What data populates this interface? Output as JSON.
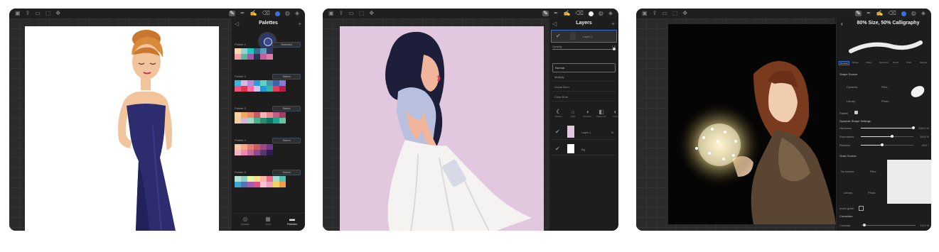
{
  "screen1": {
    "panel_title": "Palettes",
    "palettes": [
      {
        "name": "Palette 1",
        "button": "Selected",
        "colors": [
          "#f6d9b3",
          "#9ad0c8",
          "#1fc7c1",
          "#3c6c8a",
          "#5a9fc0",
          "#3a3a6a",
          "#f1a1a9",
          "#5fb3a0",
          "#9b5ea6",
          "#27344d",
          "#c55e9c",
          "#e07aa8"
        ]
      },
      {
        "name": "Palette 2",
        "button": "Select",
        "colors": [
          "#3fb3d7",
          "#d9b2e6",
          "#b58ad8",
          "#2e9bd8",
          "#5fd2c4",
          "#4a8fb0",
          "#3c64a8",
          "#8a7ad6",
          "#f0557b",
          "#e7334a",
          "#ff6b9a",
          "#d8c3e8",
          "#1e9ad6",
          "#2dbba3",
          "#e33d5f",
          "#b71e45"
        ]
      },
      {
        "name": "Palette 3",
        "button": "Select",
        "colors": [
          "#f6d3a1",
          "#f0a85a",
          "#e88a6c",
          "#c95a6a",
          "#f6b2b7",
          "#e9848f",
          "#c25d82",
          "#a33f5e",
          "#f1cfa1",
          "#d7b4d3",
          "#a4d7c7",
          "#4bb38b",
          "#2c8a6e",
          "#0b7763",
          "#1da38d",
          "#67c59f"
        ]
      },
      {
        "name": "Palette 4",
        "button": "Select",
        "colors": [
          "#f4c9a8",
          "#f7a68a",
          "#e67b72",
          "#cc5a63",
          "#9a4a83",
          "#6b3a8e",
          "#f3b3c8",
          "#e98bb0",
          "#c4669c",
          "#8c4c8c",
          "#55386d",
          "#2d1e4f"
        ]
      },
      {
        "name": "Palette 5",
        "button": "Select",
        "colors": [
          "#b8e3d0",
          "#8fd1c2",
          "#e6f5a7",
          "#f9e28c",
          "#f7b7a3",
          "#e86d8d",
          "#9fe0d3",
          "#56c3b0",
          "#3fa6c9",
          "#5471b9",
          "#a45bb4",
          "#e24e86",
          "#f7c3d5",
          "#f19bbd",
          "#f2d15a",
          "#f59b4b"
        ]
      }
    ],
    "bottom_tabs": [
      "Details",
      "Grid",
      "Palettes"
    ]
  },
  "screen2": {
    "panel_title": "Layers",
    "layer_top": "Layer 2",
    "opacity_label": "Opacity",
    "opacity_value": "1.0",
    "blend_modes": [
      "Normal",
      "Multiply",
      "Linear Burn",
      "Color Burn"
    ],
    "mode_tabs": [
      "Darken",
      "Light",
      "Contrast",
      "Difference",
      "Color"
    ],
    "layers": [
      "Layer 1",
      "Bg"
    ]
  },
  "screen3": {
    "panel_title": "80% Size, 50% Calligraphy",
    "tabs": [
      "General",
      "Stroke",
      "Shape",
      "Dynamics",
      "Pencil",
      "Grain",
      "Sample"
    ],
    "shape_source_label": "Shape Source",
    "shape_options": [
      "Dynamic",
      "Files",
      "Library",
      "Photo"
    ],
    "flatten_label": "Flatten",
    "dynamic_settings_label": "Dynamic Shape Settings",
    "sliders": [
      {
        "label": "Hardness",
        "value": "100.0 %",
        "fill": 1.0
      },
      {
        "label": "Roundness",
        "value": "60.8 %",
        "fill": 0.6
      },
      {
        "label": "Rotation",
        "value": "49.0 °",
        "fill": 0.4
      }
    ],
    "grain_source_label": "Grain Source",
    "grain_options": [
      "No texture",
      "Files",
      "Library",
      "Photo"
    ],
    "invert_label": "Invert grain",
    "correction_label": "Correction",
    "contrast_label": "Contrast",
    "contrast_value": "10.0 %"
  },
  "colors": {
    "accent": "#3f6fd8",
    "panel": "#1d1d1d",
    "frame": "#1a1a1a"
  }
}
